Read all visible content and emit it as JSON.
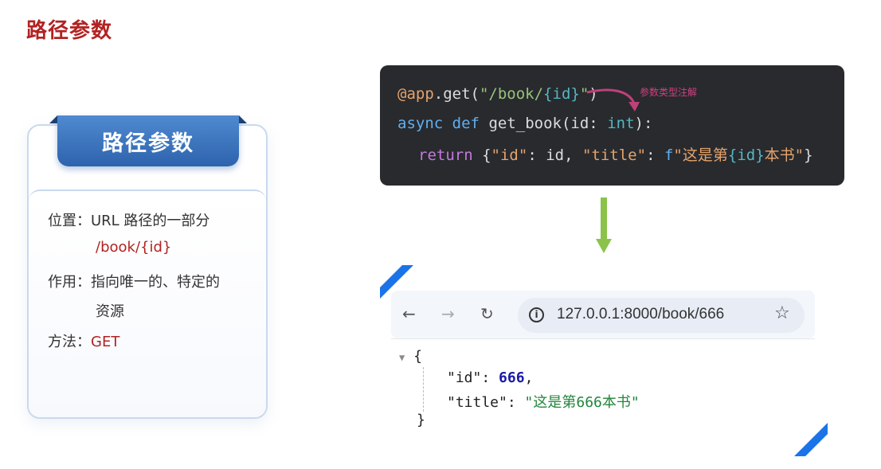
{
  "page_title": "路径参数",
  "card": {
    "tab_label": "路径参数",
    "position_label": "位置：",
    "position_value": "URL 路径的一部分",
    "position_example": "/book/{id}",
    "purpose_label": "作用：",
    "purpose_value_1": "指向唯一的、特定的",
    "purpose_value_2": "资源",
    "method_label": "方法：",
    "method_value": "GET"
  },
  "code": {
    "annotation": "参数类型注解",
    "line1": {
      "decorator": "@app",
      "dot_get": ".get(",
      "path_a": "\"/book/",
      "brace_open": "{",
      "param": "id",
      "brace_close": "}",
      "path_b": "\"",
      "close": ")"
    },
    "line2": {
      "async": "async",
      "def": "def",
      "fn": "get_book",
      "paren": "(",
      "param": "id",
      "colon": ": ",
      "type": "int",
      "end": "):"
    },
    "line3": {
      "return": "return",
      "open": "{",
      "k1": "\"id\"",
      "sep1": ": ",
      "v1": "id",
      "comma": ", ",
      "k2": "\"title\"",
      "sep2": ": ",
      "f": "f",
      "s1": "\"这是第",
      "b1": "{",
      "id": "id",
      "b2": "}",
      "s2": "本书\"",
      "close": "}"
    }
  },
  "browser": {
    "url": "127.0.0.1:8000/book/666",
    "json_open": "{",
    "id_key": "\"id\"",
    "id_value": "666",
    "title_key": "\"title\"",
    "title_value": "\"这是第666本书\"",
    "json_close": "}"
  },
  "colors": {
    "title_red": "#b22222",
    "tab_blue": "#2e63ad",
    "arrow_green": "#8bc34a",
    "corner_blue": "#1a73e8"
  }
}
